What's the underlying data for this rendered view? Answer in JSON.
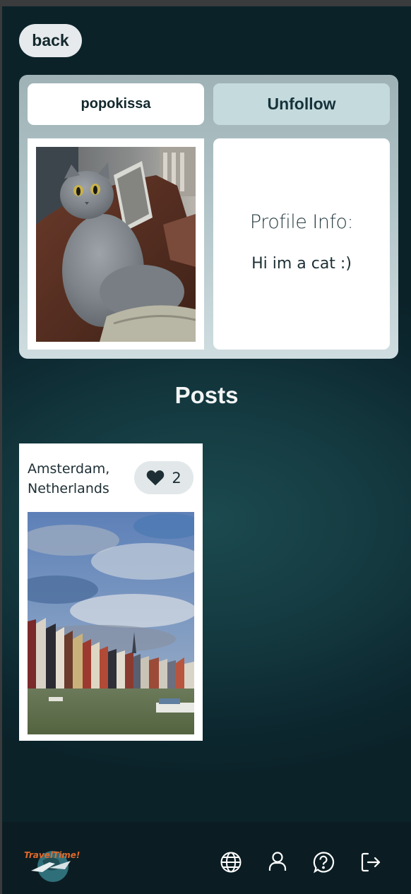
{
  "app": {
    "logo_text": "TravelTime!"
  },
  "header": {
    "back_label": "back"
  },
  "profile": {
    "username": "popokissa",
    "follow_button_label": "Unfollow",
    "info_title": "Profile Info:",
    "bio": "Hi im a cat :)",
    "avatar_alt": "grey scottish fold cat sitting on a sofa"
  },
  "posts": {
    "heading": "Posts",
    "items": [
      {
        "location": "Amsterdam, Netherlands",
        "likes": "2",
        "image_alt": "Amsterdam canal houses under a cloudy sky"
      }
    ]
  },
  "nav": {
    "icons": [
      "globe-icon",
      "user-icon",
      "help-icon",
      "logout-icon"
    ]
  },
  "colors": {
    "background": "#0b2229",
    "card_gradient_top": "#9fb2b6",
    "unfollow_bg": "#c4dadd",
    "text_dark": "#13282d",
    "heading_light": "#f3f4f4",
    "nav_bg": "#0b1d23"
  }
}
